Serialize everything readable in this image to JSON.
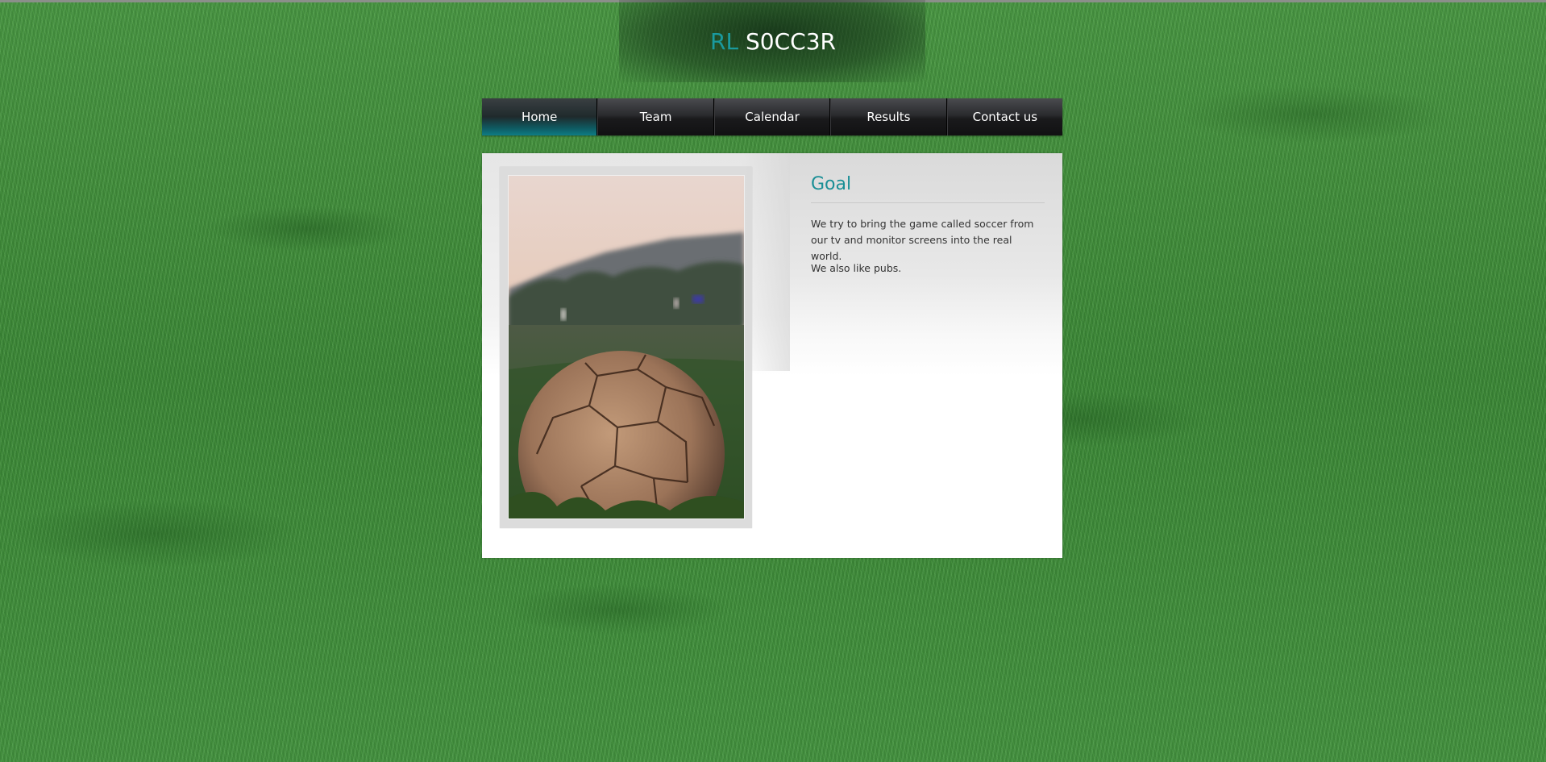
{
  "brand": {
    "accent_text": "RL",
    "main_text": "S0CC3R",
    "accent_color": "#1a9a9e"
  },
  "nav": {
    "items": [
      {
        "label": "Home",
        "active": true
      },
      {
        "label": "Team",
        "active": false
      },
      {
        "label": "Calendar",
        "active": false
      },
      {
        "label": "Results",
        "active": false
      },
      {
        "label": "Contact us",
        "active": false
      }
    ]
  },
  "article": {
    "title": "Goal",
    "paragraphs": [
      "We try to bring the game called soccer from our tv and monitor screens into the real world.",
      "We also like pubs."
    ]
  },
  "colors": {
    "background": "#3f8a3a",
    "nav_active": "#0e7d85",
    "title": "#1a8f96"
  }
}
